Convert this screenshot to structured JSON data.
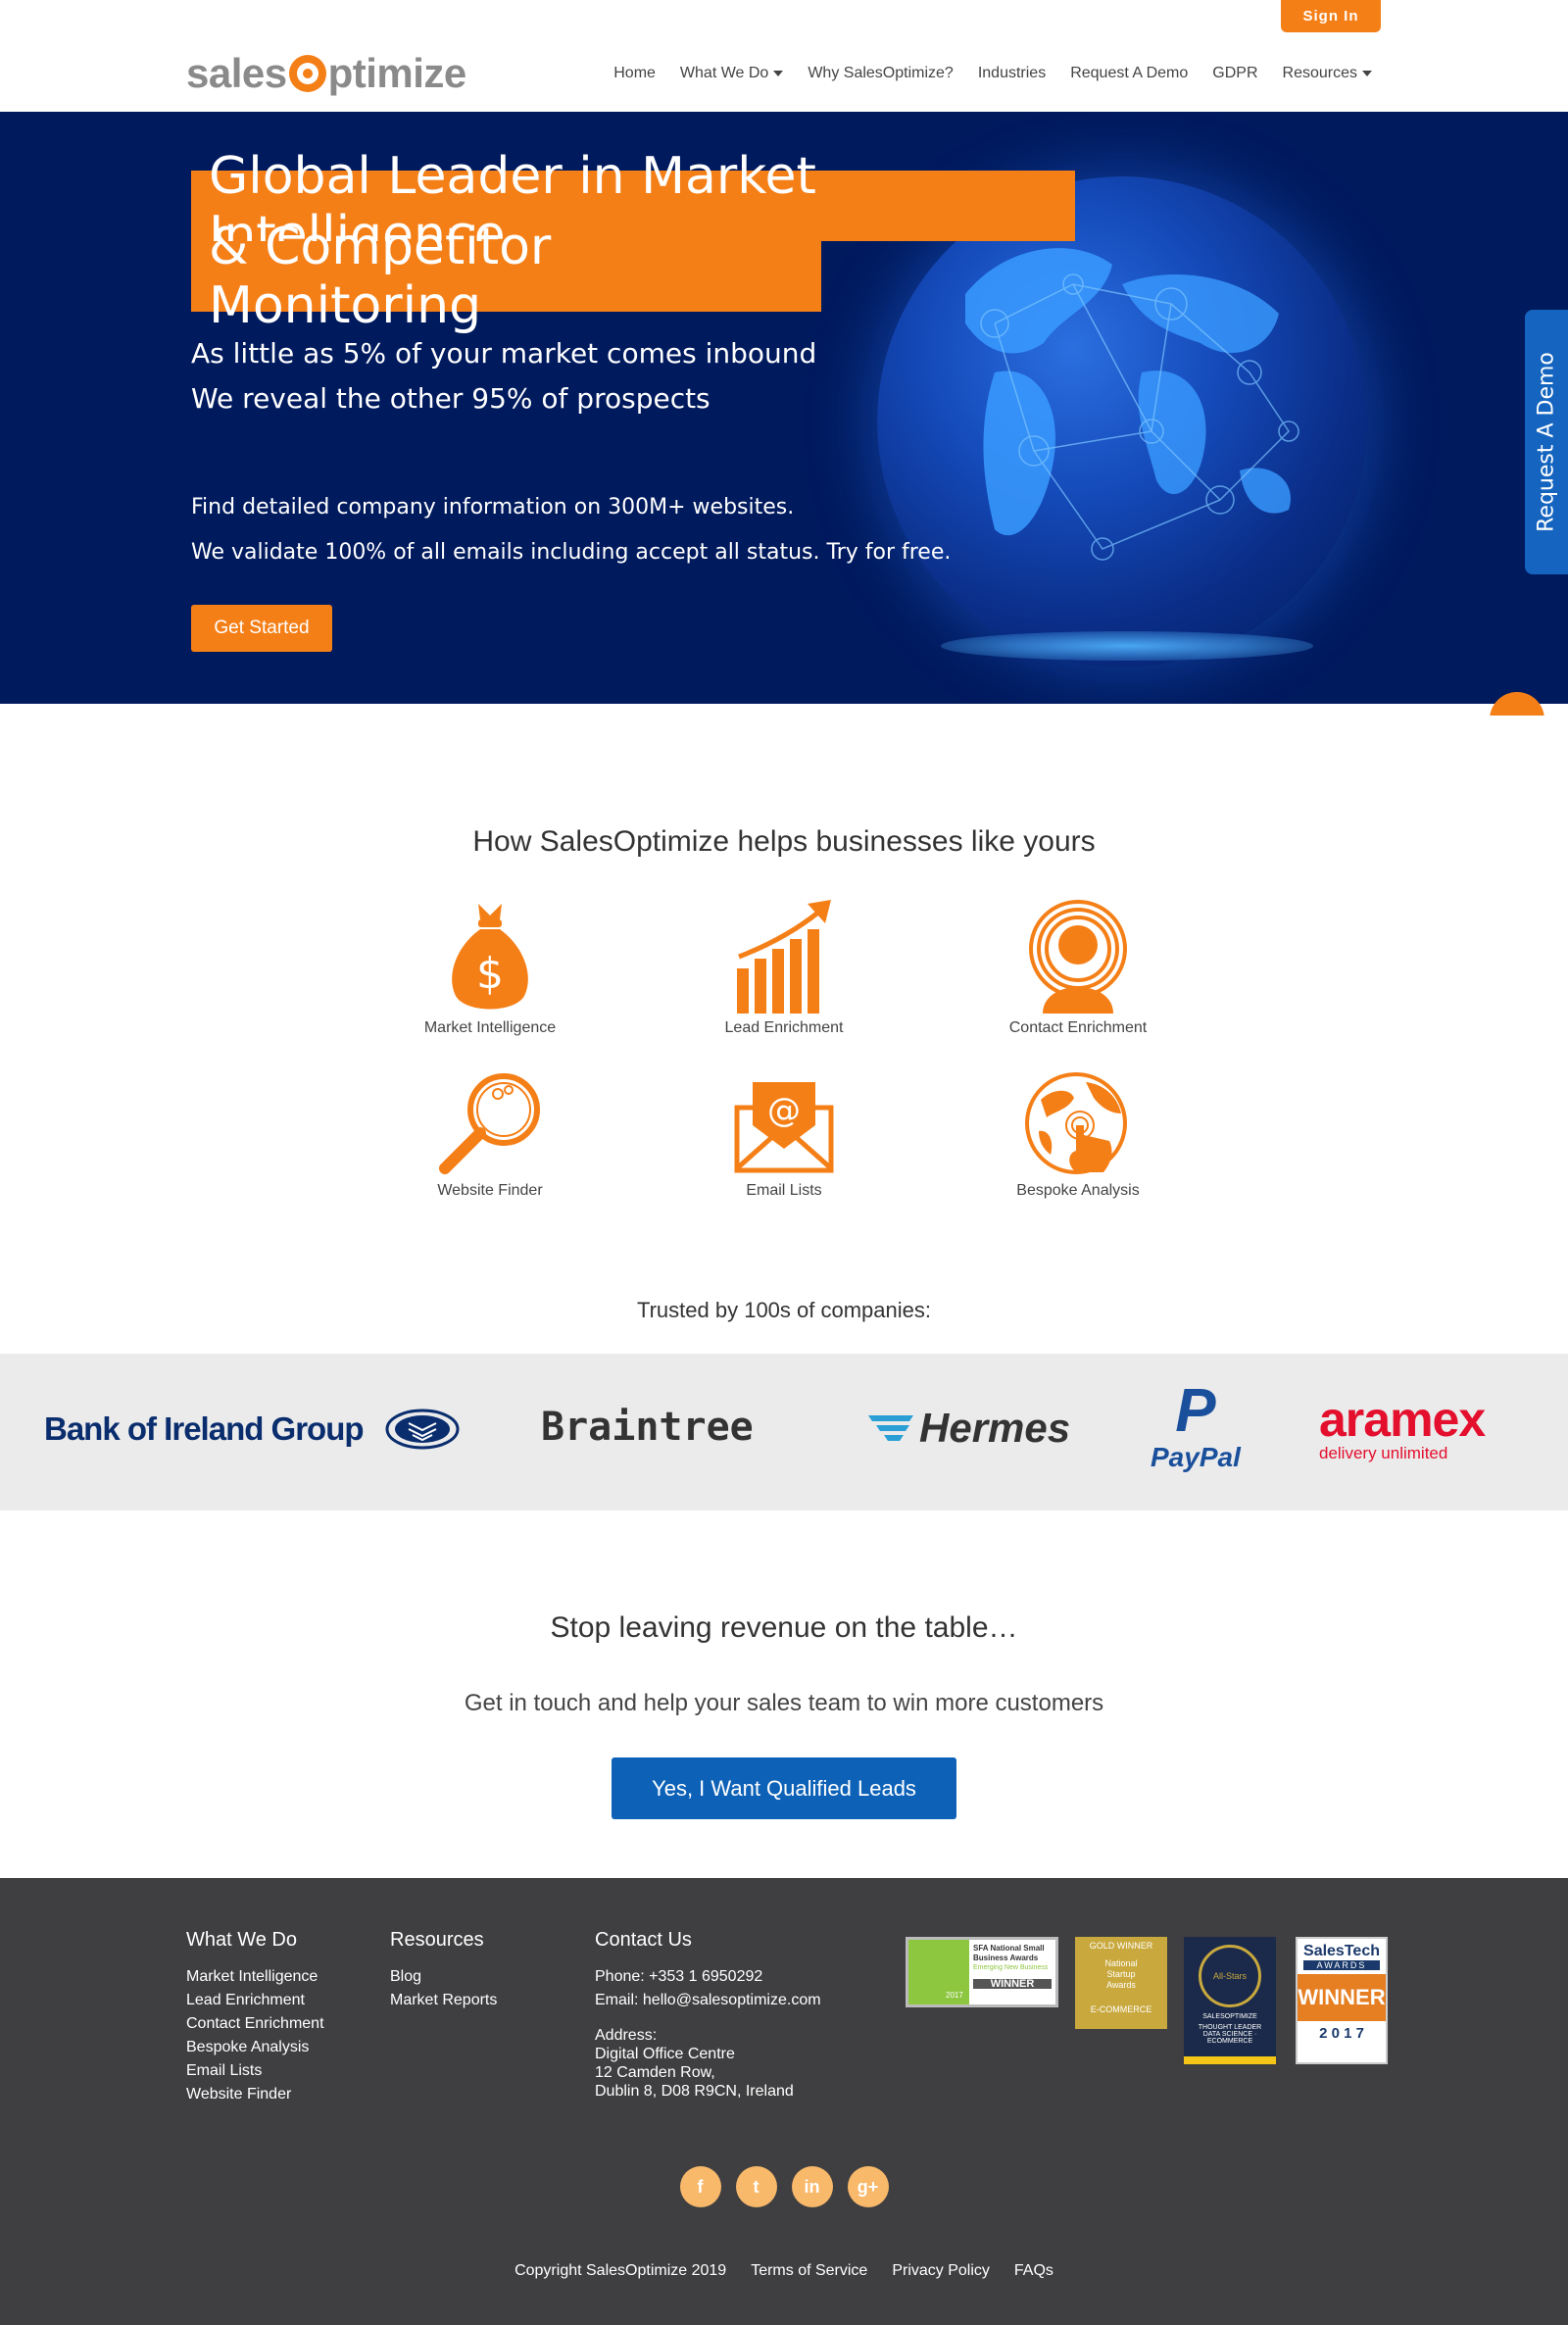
{
  "header": {
    "sign_in": "Sign In",
    "logo_text_left": "sales",
    "logo_text_right": "ptimize",
    "nav": [
      {
        "label": "Home",
        "dropdown": false
      },
      {
        "label": "What We Do",
        "dropdown": true
      },
      {
        "label": "Why SalesOptimize?",
        "dropdown": false
      },
      {
        "label": "Industries",
        "dropdown": false
      },
      {
        "label": "Request A Demo",
        "dropdown": false
      },
      {
        "label": "GDPR",
        "dropdown": false
      },
      {
        "label": "Resources",
        "dropdown": true
      }
    ]
  },
  "hero": {
    "title_line1": "Global Leader in Market Intelligence",
    "title_line2": "& Competitor Monitoring",
    "sub_line1": "As little as 5% of your market comes inbound",
    "sub_line2": "We reveal the other 95% of prospects",
    "p_line1": "Find detailed company information on 300M+ websites.",
    "p_line2": "We validate 100% of all emails including accept all status. Try for free.",
    "cta": "Get Started",
    "side_tab": "Request A Demo"
  },
  "helps": {
    "title": "How SalesOptimize helps businesses like yours",
    "features": [
      {
        "label": "Market Intelligence",
        "icon": "money-bag-icon"
      },
      {
        "label": "Lead Enrichment",
        "icon": "growth-chart-icon"
      },
      {
        "label": "Contact Enrichment",
        "icon": "contact-person-icon"
      },
      {
        "label": "Website Finder",
        "icon": "magnifier-icon"
      },
      {
        "label": "Email Lists",
        "icon": "email-envelope-icon"
      },
      {
        "label": "Bespoke Analysis",
        "icon": "globe-touch-icon"
      }
    ]
  },
  "trusted": {
    "title": "Trusted by 100s of companies:",
    "logos": [
      "Bank of Ireland Group",
      "Braintree",
      "Hermes",
      "PayPal",
      "aramex"
    ],
    "aramex_tagline": "delivery unlimited",
    "paypal_mark": "P"
  },
  "cta": {
    "title": "Stop leaving revenue on the table…",
    "sub": "Get in touch and help your sales team to win more customers",
    "button": "Yes, I Want Qualified Leads"
  },
  "footer": {
    "what_we_do": {
      "title": "What We Do",
      "links": [
        "Market Intelligence",
        "Lead Enrichment",
        "Contact Enrichment",
        "Bespoke Analysis",
        "Email Lists",
        "Website Finder"
      ]
    },
    "resources": {
      "title": "Resources",
      "links": [
        "Blog",
        "Market Reports"
      ]
    },
    "contact": {
      "title": "Contact Us",
      "phone": "Phone: +353 1 6950292",
      "email": "Email: hello@salesoptimize.com",
      "address_label": "Address:",
      "address": [
        "Digital Office Centre",
        "12 Camden Row,",
        "Dublin 8, D08 R9CN, Ireland"
      ]
    },
    "awards": {
      "sfa_line1": "SFA National Small",
      "sfa_line2": "Business Awards",
      "sfa_line3": "Emerging New Business",
      "sfa_year": "2017",
      "sfa_result": "WINNER",
      "gold_title": "GOLD WINNER",
      "gold_line1": "National",
      "gold_line2": "Startup",
      "gold_line3": "Awards",
      "gold_category": "E-COMMERCE",
      "allstars_name": "All-Stars",
      "allstars_org": "SALESOPTIMIZE",
      "allstars_line1": "THOUGHT LEADER",
      "allstars_line2": "DATA SCIENCE · ECOMMERCE",
      "salestech_title": "SalesTech",
      "salestech_sub": "AWARDS",
      "salestech_result": "WINNER",
      "salestech_year": "2 0 1 7"
    },
    "social": [
      "f",
      "t",
      "in",
      "g+"
    ],
    "bottom": [
      "Copyright SalesOptimize 2019",
      "Terms of Service",
      "Privacy Policy",
      "FAQs"
    ]
  },
  "colors": {
    "brand_orange": "#f57f17",
    "hero_navy": "#001a5e",
    "cta_blue": "#0d62b8",
    "footer_bg": "#3f3f41"
  }
}
